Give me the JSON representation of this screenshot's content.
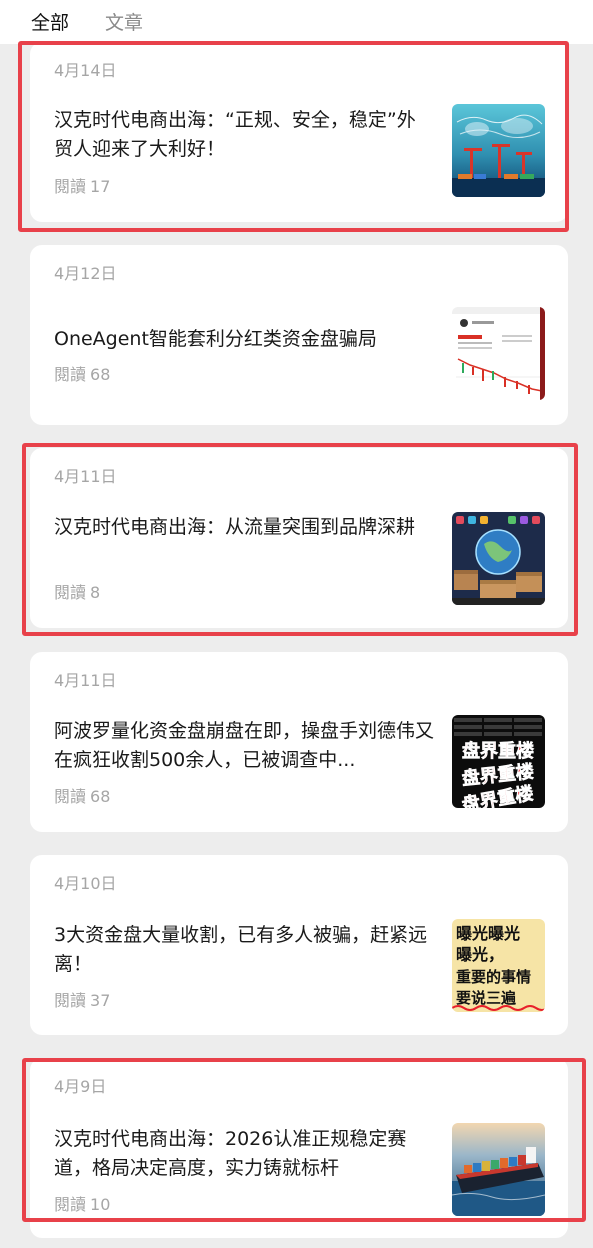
{
  "tabs": [
    {
      "label": "全部",
      "active": true
    },
    {
      "label": "文章",
      "active": false
    }
  ],
  "articles": [
    {
      "date": "4月14日",
      "title": "汉克时代电商出海：“正规、安全，稳定”外贸人迎来了大利好！",
      "reads_label": "閱讀",
      "reads": "17",
      "thumbnail": "port-cranes-world-map"
    },
    {
      "date": "4月12日",
      "title": "OneAgent智能套利分红类资金盘骗局",
      "reads_label": "閱讀",
      "reads": "68",
      "thumbnail": "trading-app-screenshot"
    },
    {
      "date": "4月11日",
      "title": "汉克时代电商出海：从流量突围到品牌深耕",
      "reads_label": "閱讀",
      "reads": "8",
      "thumbnail": "globe-boxes-laptop"
    },
    {
      "date": "4月11日",
      "title": "阿波罗量化资金盘崩盘在即，操盘手刘德伟又在疯狂收割500余人，已被调查中...",
      "reads_label": "閱讀",
      "reads": "68",
      "thumbnail": "red-warning-text"
    },
    {
      "date": "4月10日",
      "title": "3大资金盘大量收割，已有多人被骗，赶紧远离！",
      "reads_label": "閱讀",
      "reads": "37",
      "thumbnail": "yellow-notice-card"
    },
    {
      "date": "4月9日",
      "title": "汉克时代电商出海：2026认准正规稳定赛道，格局决定高度，实力铸就标杆",
      "reads_label": "閱讀",
      "reads": "10",
      "thumbnail": "container-ship"
    }
  ],
  "thumb_text": {
    "warning": "盘界重楼",
    "notice_line1": "曝光曝光",
    "notice_line2": "曝光，",
    "notice_line3": "重要的事情",
    "notice_line4": "要说三遍"
  },
  "colors": {
    "accent": "#c8102e",
    "highlight_box": "#e8414a"
  }
}
